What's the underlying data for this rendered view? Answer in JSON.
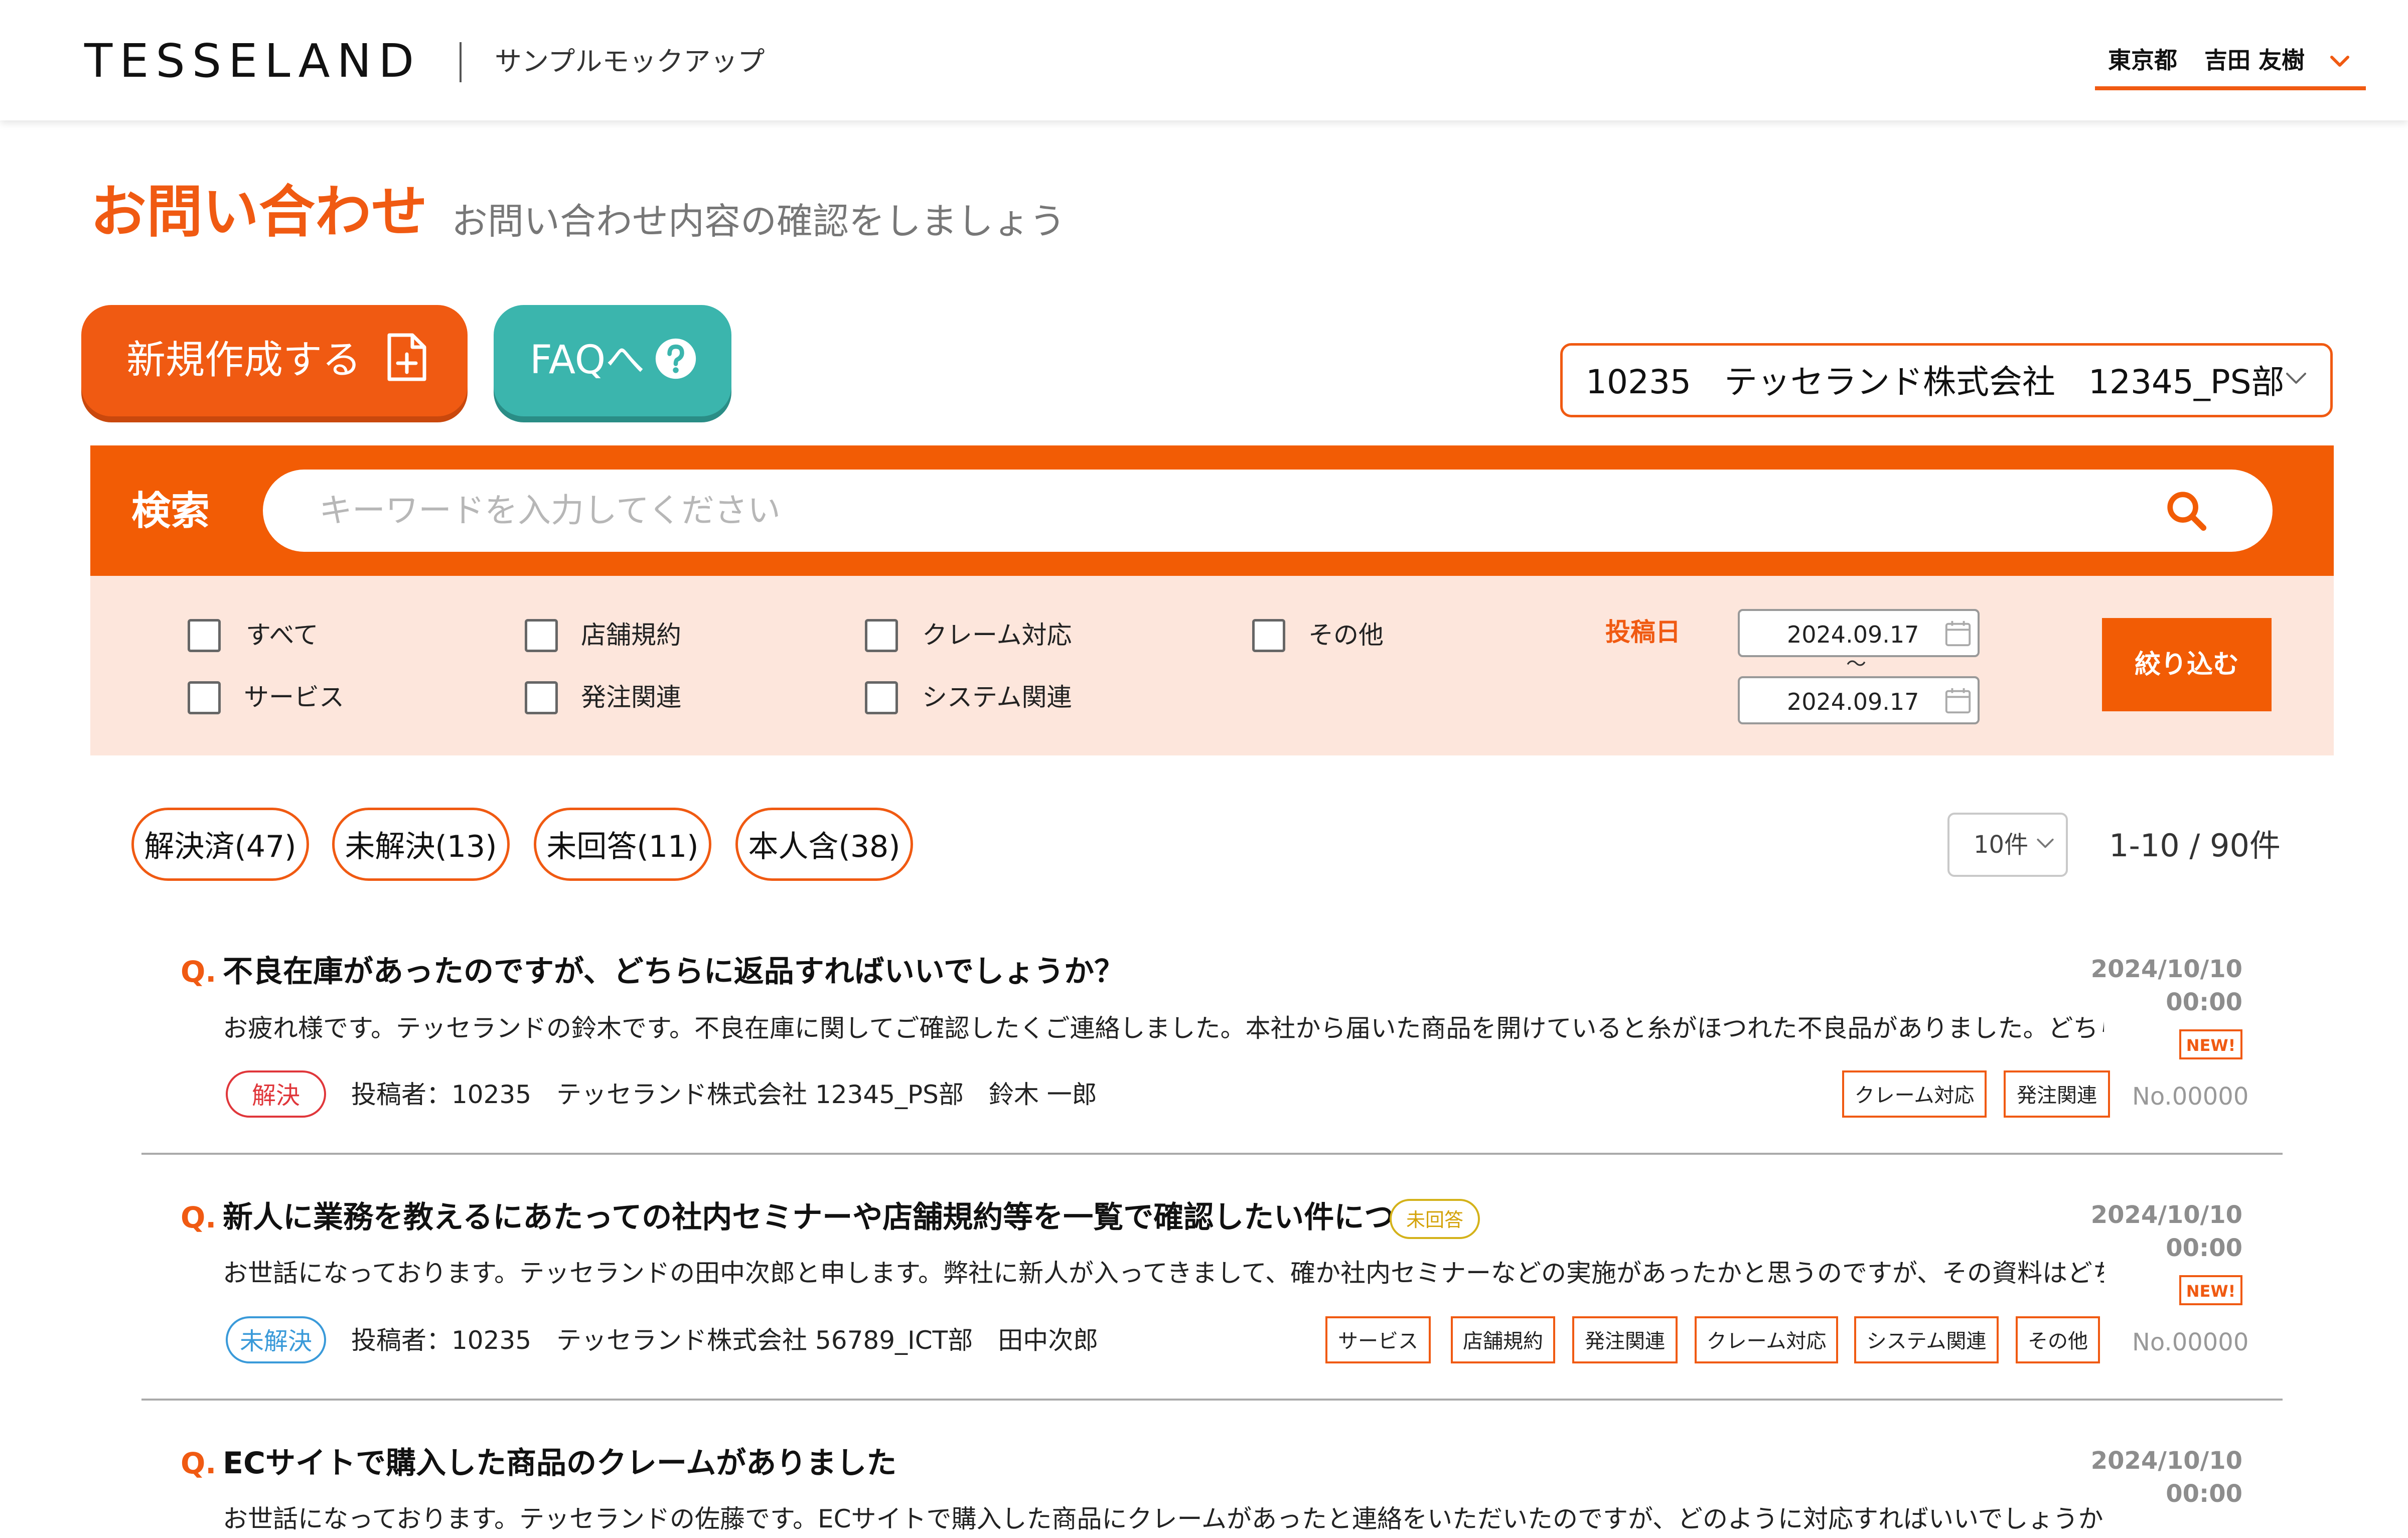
{
  "header": {
    "logo": "TESSELAND",
    "subtitle": "サンプルモックアップ",
    "prefecture": "東京都",
    "user_name": "吉田 友樹"
  },
  "page": {
    "title": "お問い合わせ",
    "subtitle": "お問い合わせ内容の確認をしましょう"
  },
  "actions": {
    "new_label": "新規作成する",
    "faq_label": "FAQへ"
  },
  "company_select": {
    "value": "10235　テッセランド株式会社　12345_PS部"
  },
  "search": {
    "label": "検索",
    "placeholder": "キーワードを入力してください"
  },
  "filters": {
    "categories": [
      "すべて",
      "サービス",
      "店舗規約",
      "発注関連",
      "クレーム対応",
      "システム関連",
      "その他"
    ],
    "date_label": "投稿日",
    "date_from": "2024.09.17",
    "date_to": "2024.09.17",
    "date_separator": "～",
    "apply_label": "絞り込む"
  },
  "status_chips": [
    "解決済(47)",
    "未解決(13)",
    "未回答(11)",
    "本人含(38)"
  ],
  "pagination": {
    "per_page": "10件",
    "count": "1-10 / 90件"
  },
  "questions": [
    {
      "q_mark": "Q.",
      "title": "不良在庫があったのですが、どちらに返品すればいいでしょうか？",
      "body": "お疲れ様です。テッセランドの鈴木です。不良在庫に関してご確認したくご連絡しました。本社から届いた商品を開けていると糸がほつれた不良品がありました。どちらに返品...",
      "status": "解決",
      "poster": "投稿者：10235　テッセランド株式会社 12345_PS部　鈴木 一郎",
      "date": "2024/10/10",
      "time": "00:00",
      "new": "NEW!",
      "tags": [
        "クレーム対応",
        "発注関連"
      ],
      "number": "No.00000"
    },
    {
      "q_mark": "Q.",
      "title": "新人に業務を教えるにあたっての社内セミナーや店舗規約等を一覧で確認したい件について",
      "unanswered": "未回答",
      "body": "お世話になっております。テッセランドの田中次郎と申します。弊社に新人が入ってきまして、確か社内セミナーなどの実施があったかと思うのですが、その資料はどちらあります...",
      "status": "未解決",
      "poster": "投稿者：10235　テッセランド株式会社 56789_ICT部　田中次郎",
      "date": "2024/10/10",
      "time": "00:00",
      "new": "NEW!",
      "tags": [
        "サービス",
        "店舗規約",
        "発注関連",
        "クレーム対応",
        "システム関連",
        "その他"
      ],
      "number": "No.00000"
    },
    {
      "q_mark": "Q.",
      "title": "ECサイトで購入した商品のクレームがありました",
      "body": "お世話になっております。テッセランドの佐藤です。ECサイトで購入した商品にクレームがあったと連絡をいただいたのですが、どのように対応すればいいでしょうか？お手数です...",
      "date": "2024/10/10",
      "time": "00:00"
    }
  ],
  "colors": {
    "accent": "#f05a12",
    "teal": "#3bb5ad",
    "filter_bg": "#fde6dc",
    "solved": "#e0373b",
    "unsolved": "#3a9ad9",
    "unanswered": "#d4b21a"
  },
  "icons": {
    "new": "document-plus-icon",
    "faq": "question-circle-icon",
    "search": "search-icon",
    "calendar": "calendar-icon",
    "chevron": "chevron-down-icon"
  }
}
